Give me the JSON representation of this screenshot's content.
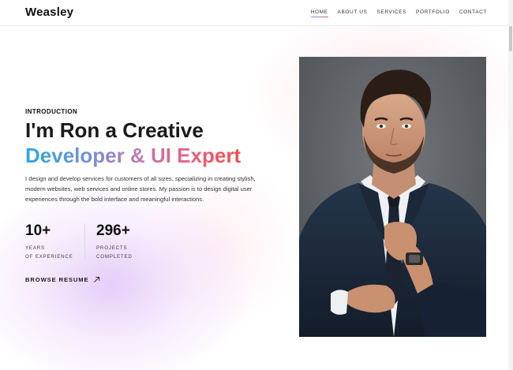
{
  "header": {
    "logo": "Weasley",
    "nav": [
      {
        "label": "HOME",
        "active": true
      },
      {
        "label": "ABOUT US",
        "active": false
      },
      {
        "label": "SERVICES",
        "active": false
      },
      {
        "label": "PORTFOLIO",
        "active": false
      },
      {
        "label": "CONTACT",
        "active": false
      }
    ]
  },
  "hero": {
    "eyebrow": "INTRODUCTION",
    "headline_line1": "I'm Ron a Creative",
    "headline_line2": "Developer & UI Expert",
    "description": "I design and develop services for customers of all sizes, specializing in creating stylish, modern websites, web services and online stores. My passion is to design digital user experiences through the bold interface and meaningful interactions.",
    "stats": [
      {
        "value": "10+",
        "label_line1": "YEARS",
        "label_line2": "OF EXPERIENCE"
      },
      {
        "value": "296+",
        "label_line1": "PROJECTS",
        "label_line2": "COMPLETED"
      }
    ],
    "cta_label": "BROWSE RESUME",
    "cta_icon": "arrow-up-right-icon",
    "portrait": "man-in-suit-adjusting-tie-photo"
  },
  "colors": {
    "gradient_start": "#2aa9e0",
    "gradient_end": "#f04e4e",
    "text": "#1a1a1a"
  }
}
